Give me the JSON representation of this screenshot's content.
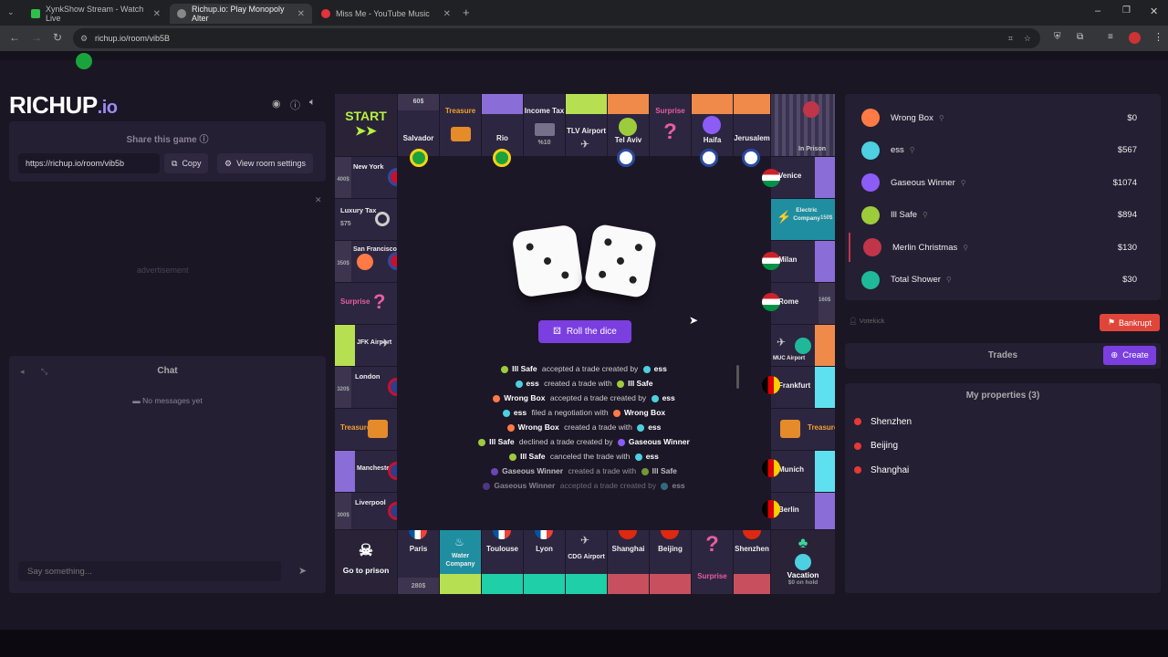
{
  "browser": {
    "tabs": [
      {
        "title": "XynkShow Stream - Watch Live",
        "color": "#2fbf4a"
      },
      {
        "title": "Richup.io: Play Monopoly Alter",
        "color": "#888888"
      },
      {
        "title": "Miss Me - YouTube Music",
        "color": "#e5323b"
      }
    ],
    "url": "richup.io/room/vib5B"
  },
  "sidebar": {
    "logo": "RICHUP",
    "logo_suffix": ".io",
    "share_title": "Share this game",
    "share_url": "https://richup.io/room/vib5b",
    "copy_label": "Copy",
    "settings_label": "View room settings",
    "ad_label": "advertisement",
    "chat_title": "Chat",
    "no_messages": "No messages yet",
    "chat_placeholder": "Say something..."
  },
  "board": {
    "start": "START",
    "go_to_prison": "Go to prison",
    "vacation": "Vacation",
    "vacation_sub": "$0 on hold",
    "in_prison": "In Prison",
    "top": [
      "60$",
      "Salvador",
      "Treasure",
      "Rio",
      "Income Tax",
      "%10",
      "TLV Airport",
      "Tel Aviv",
      "Surprise",
      "Haifa",
      "Jerusalem"
    ],
    "bottom": [
      "Paris",
      "280$",
      "Water Company",
      "Toulouse",
      "Lyon",
      "CDG Airport",
      "Shanghai",
      "Beijing",
      "Surprise",
      "Shenzhen"
    ],
    "left": [
      "New York",
      "400$",
      "Luxury Tax",
      "$75",
      "San Francisco",
      "350$",
      "Surprise",
      "JFK Airport",
      "London",
      "320$",
      "Treasure",
      "Manchester",
      "Liverpool",
      "300$"
    ],
    "right": [
      "Venice",
      "Electric Company",
      "150$",
      "Milan",
      "Rome",
      "160$",
      "MUC Airport",
      "Frankfurt",
      "Treasure",
      "Munich",
      "Berlin"
    ]
  },
  "dice": [
    3,
    5
  ],
  "roll_label": "Roll the dice",
  "log": [
    {
      "a": "Ill Safe",
      "ac": "#9ccc3c",
      "verb": "accepted a trade created by",
      "b": "ess",
      "bc": "#4dd0e1"
    },
    {
      "a": "ess",
      "ac": "#4dd0e1",
      "verb": "created a trade with",
      "b": "Ill Safe",
      "bc": "#9ccc3c"
    },
    {
      "a": "Wrong Box",
      "ac": "#ff7a45",
      "verb": "accepted a trade created by",
      "b": "ess",
      "bc": "#4dd0e1"
    },
    {
      "a": "ess",
      "ac": "#4dd0e1",
      "verb": "filed a negotiation with",
      "b": "Wrong Box",
      "bc": "#ff7a45"
    },
    {
      "a": "Wrong Box",
      "ac": "#ff7a45",
      "verb": "created a trade with",
      "b": "ess",
      "bc": "#4dd0e1"
    },
    {
      "a": "Ill Safe",
      "ac": "#9ccc3c",
      "verb": "declined a trade created by",
      "b": "Gaseous Winner",
      "bc": "#8b5cf6"
    },
    {
      "a": "Ill Safe",
      "ac": "#9ccc3c",
      "verb": "canceled the trade with",
      "b": "ess",
      "bc": "#4dd0e1"
    },
    {
      "a": "Gaseous Winner",
      "ac": "#8b5cf6",
      "verb": "created a trade with",
      "b": "Ill Safe",
      "bc": "#9ccc3c"
    },
    {
      "a": "Gaseous Winner",
      "ac": "#8b5cf6",
      "verb": "accepted a trade created by",
      "b": "ess",
      "bc": "#4dd0e1"
    }
  ],
  "players": [
    {
      "name": "Wrong Box",
      "money": "$0",
      "color": "#ff7a45"
    },
    {
      "name": "ess",
      "money": "$567",
      "color": "#4dd0e1"
    },
    {
      "name": "Gaseous Winner",
      "money": "$1074",
      "color": "#8b5cf6"
    },
    {
      "name": "Ill Safe",
      "money": "$894",
      "color": "#9ccc3c"
    },
    {
      "name": "Merlin Christmas",
      "money": "$130",
      "color": "#c0354a"
    },
    {
      "name": "Total Shower",
      "money": "$30",
      "color": "#1fb99a"
    }
  ],
  "votekick": "Votekick",
  "bankrupt": "Bankrupt",
  "trades_title": "Trades",
  "create_label": "Create",
  "my_properties_title": "My properties (3)",
  "my_properties": [
    "Shenzhen",
    "Beijing",
    "Shanghai"
  ]
}
